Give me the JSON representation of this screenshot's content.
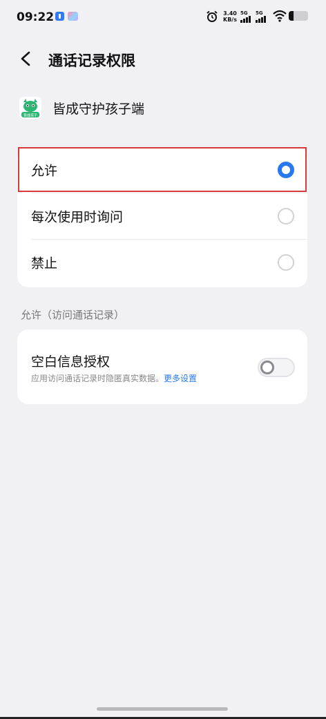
{
  "status_bar": {
    "time": "09:22",
    "speed_value": "3.40",
    "speed_unit": "KB/s",
    "signal1_label": "5G",
    "signal2_label": "5G",
    "battery_level": 0.25
  },
  "header": {
    "title": "通话记录权限"
  },
  "app": {
    "name": "皆成守护孩子端",
    "icon_caption": "皆成孩子"
  },
  "options": [
    {
      "label": "允许",
      "selected": true
    },
    {
      "label": "每次使用时询问",
      "selected": false
    },
    {
      "label": "禁止",
      "selected": false
    }
  ],
  "section": {
    "label": "允许（访问通话记录）"
  },
  "toggle_card": {
    "title": "空白信息授权",
    "description": "应用访问通话记录时隐匿真实数据。",
    "link": "更多设置",
    "enabled": false
  },
  "colors": {
    "accent": "#2878f0",
    "highlight": "#d63a3a",
    "app_green": "#2bb673"
  }
}
